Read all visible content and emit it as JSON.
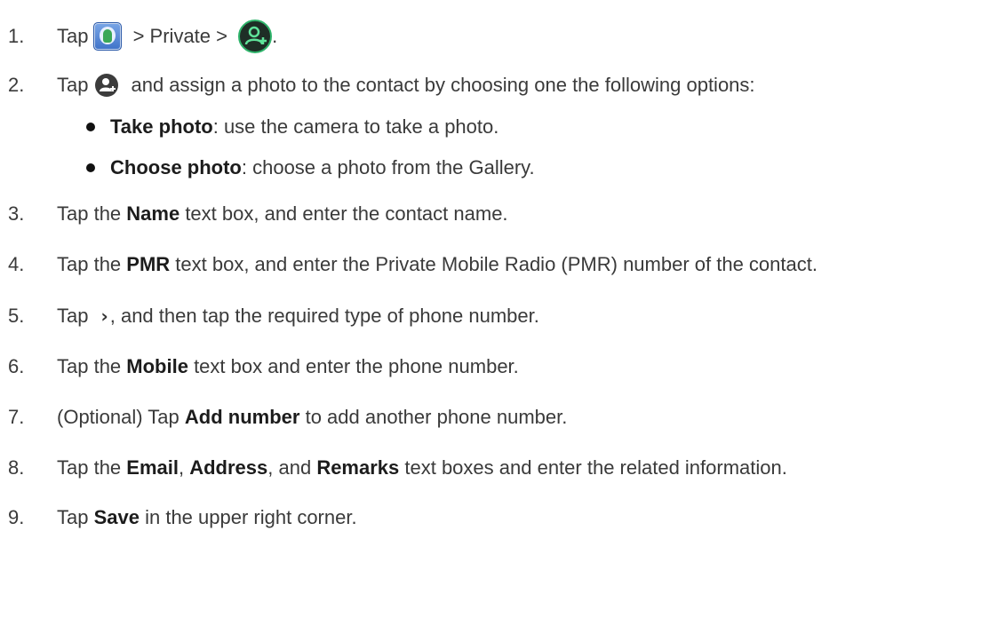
{
  "steps": [
    {
      "num": "1.",
      "tap": "Tap",
      "sep1": " > Private > ",
      "end": "."
    },
    {
      "num": "2.",
      "tap": "Tap",
      "rest": "and assign a photo to the contact by choosing one the following options:"
    },
    {
      "num": "3.",
      "pre": "Tap the ",
      "bold": "Name",
      "post": " text box, and enter the contact name."
    },
    {
      "num": "4.",
      "pre": "Tap the ",
      "bold": "PMR",
      "post": " text box, and enter the Private Mobile Radio (PMR) number of the contact."
    },
    {
      "num": "5.",
      "tap": "Tap",
      "post": ", and then tap the required type of phone number."
    },
    {
      "num": "6.",
      "pre": "Tap the ",
      "bold": "Mobile",
      "post": " text box and enter the phone number."
    },
    {
      "num": "7.",
      "pre": "(Optional) Tap ",
      "bold": "Add number",
      "post": " to add another phone number."
    },
    {
      "num": "8.",
      "pre": "Tap the ",
      "bold1": "Email",
      "mid1": ", ",
      "bold2": "Address",
      "mid2": ", and ",
      "bold3": "Remarks",
      "post": " text boxes and enter the related information."
    },
    {
      "num": "9.",
      "pre": "Tap ",
      "bold": "Save",
      "post": " in the upper right corner."
    }
  ],
  "bullets": [
    {
      "bold": "Take photo",
      "rest": ": use the camera to take a photo."
    },
    {
      "bold": "Choose photo",
      "rest": ": choose a photo from the Gallery."
    }
  ],
  "icons": {
    "contacts": "contacts-app-icon",
    "add_contact_green": "add-contact-icon",
    "add_photo": "add-photo-icon",
    "chevron": "chevron-right-icon",
    "chevron_glyph": "›"
  }
}
